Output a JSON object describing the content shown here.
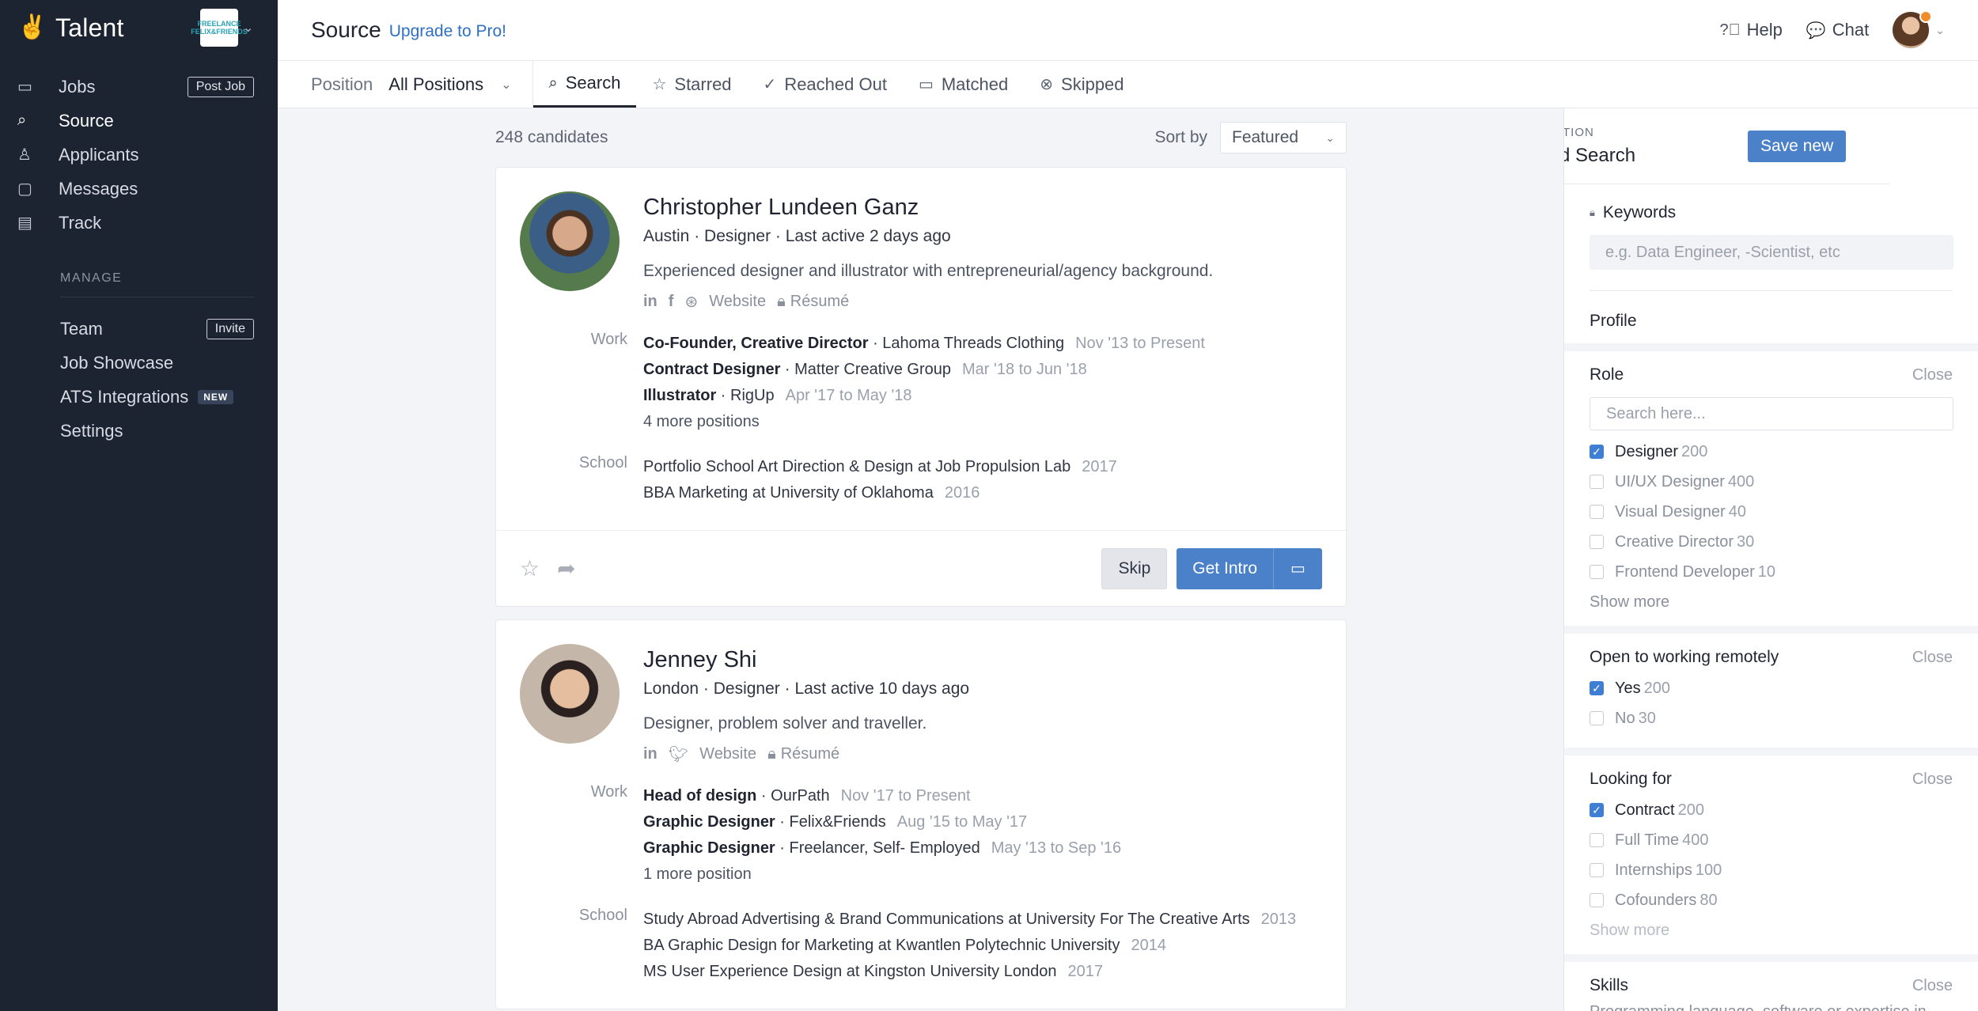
{
  "sidebar": {
    "brand": "Talent",
    "company_logo_text": "FREELANCE FELIX&FRIENDS",
    "nav": [
      {
        "label": "Jobs",
        "icon": "briefcase-icon",
        "pill": "Post Job"
      },
      {
        "label": "Source",
        "icon": "search-icon",
        "active": true
      },
      {
        "label": "Applicants",
        "icon": "person-icon"
      },
      {
        "label": "Messages",
        "icon": "chat-icon"
      },
      {
        "label": "Track",
        "icon": "calendar-icon"
      }
    ],
    "manage_label": "MANAGE",
    "manage": [
      {
        "label": "Team",
        "pill": "Invite"
      },
      {
        "label": "Job Showcase"
      },
      {
        "label": "ATS Integrations",
        "badge": "NEW"
      },
      {
        "label": "Settings"
      }
    ]
  },
  "header": {
    "title": "Source",
    "upgrade": "Upgrade to Pro!",
    "help": "Help",
    "chat": "Chat"
  },
  "tabs": {
    "position_label": "Position",
    "position_value": "All Positions",
    "items": [
      {
        "label": "Search",
        "icon": "search-icon",
        "active": true
      },
      {
        "label": "Starred",
        "icon": "star-icon"
      },
      {
        "label": "Reached Out",
        "icon": "check-icon"
      },
      {
        "label": "Matched",
        "icon": "chat-icon"
      },
      {
        "label": "Skipped",
        "icon": "skip-icon"
      }
    ]
  },
  "list": {
    "count": "248 candidates",
    "sort_label": "Sort by",
    "sort_value": "Featured"
  },
  "candidates": [
    {
      "name": "Christopher Lundeen Ganz",
      "meta": "Austin · Designer · Last active 2 days ago",
      "bio": "Experienced designer and illustrator with entrepreneurial/agency background.",
      "links": [
        "Website",
        "Résumé"
      ],
      "work_label": "Work",
      "work": [
        {
          "title": "Co-Founder, Creative Director",
          "company": " · Lahoma Threads Clothing",
          "dates": "Nov '13 to Present"
        },
        {
          "title": "Contract Designer",
          "company": " · Matter Creative Group",
          "dates": "Mar '18 to Jun '18"
        },
        {
          "title": "Illustrator",
          "company": " · RigUp",
          "dates": "Apr '17 to May '18"
        }
      ],
      "more": "4 more positions",
      "school_label": "School",
      "school": [
        {
          "text": "Portfolio School Art Direction & Design at Job Propulsion Lab",
          "year": "2017"
        },
        {
          "text": "BBA Marketing at University of Oklahoma",
          "year": "2016"
        }
      ],
      "actions": {
        "skip": "Skip",
        "intro": "Get Intro"
      }
    },
    {
      "name": "Jenney Shi",
      "meta": "London · Designer · Last active 10 days ago",
      "bio": "Designer, problem solver and traveller.",
      "links": [
        "Website",
        "Résumé"
      ],
      "work_label": "Work",
      "work": [
        {
          "title": "Head of design",
          "company": " · OurPath",
          "dates": "Nov '17 to Present"
        },
        {
          "title": "Graphic Designer",
          "company": " · Felix&Friends",
          "dates": "Aug '15 to May '17"
        },
        {
          "title": "Graphic Designer",
          "company": " · Freelancer, Self- Employed",
          "dates": "May '13 to Sep '16"
        }
      ],
      "more": "1 more position",
      "school_label": "School",
      "school": [
        {
          "text": "Study Abroad Advertising & Brand Communications at University For The Creative Arts",
          "year": "2013"
        },
        {
          "text": "BA Graphic Design for Marketing at Kwantlen Polytechnic University",
          "year": "2014"
        },
        {
          "text": "MS User Experience Design at Kingston University London",
          "year": "2017"
        }
      ]
    }
  ],
  "filters": {
    "small_label": "TION",
    "title": "d Search",
    "save": "Save new",
    "keywords_label": "Keywords",
    "keywords_placeholder": "e.g. Data Engineer, -Scientist, etc",
    "profile_label": "Profile",
    "close": "Close",
    "role": {
      "title": "Role",
      "search_placeholder": "Search here...",
      "options": [
        {
          "label": "Designer",
          "count": "200",
          "checked": true
        },
        {
          "label": "UI/UX Designer",
          "count": "400"
        },
        {
          "label": "Visual Designer",
          "count": "40"
        },
        {
          "label": "Creative Director",
          "count": "30"
        },
        {
          "label": "Frontend Developer",
          "count": "10"
        }
      ],
      "show_more": "Show more"
    },
    "remote": {
      "title": "Open to working remotely",
      "options": [
        {
          "label": "Yes",
          "count": "200",
          "checked": true
        },
        {
          "label": "No",
          "count": "30"
        }
      ]
    },
    "looking": {
      "title": "Looking for",
      "options": [
        {
          "label": "Contract",
          "count": "200",
          "checked": true
        },
        {
          "label": "Full Time",
          "count": "400"
        },
        {
          "label": "Internships",
          "count": "100"
        },
        {
          "label": "Cofounders",
          "count": "80"
        }
      ],
      "show_more": "Show more"
    },
    "skills": {
      "title": "Skills",
      "sub": "Programming language, software or expertise in"
    }
  }
}
